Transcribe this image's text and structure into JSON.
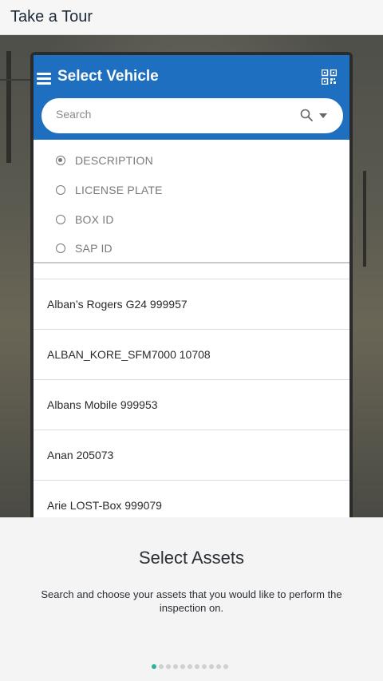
{
  "header": {
    "title": "Take a Tour"
  },
  "app": {
    "title": "Select Vehicle",
    "search_placeholder": "Search",
    "search_options": [
      {
        "label": "DESCRIPTION",
        "selected": true
      },
      {
        "label": "LICENSE PLATE",
        "selected": false
      },
      {
        "label": "BOX ID",
        "selected": false
      },
      {
        "label": "SAP ID",
        "selected": false
      }
    ],
    "vehicles": [
      "Alban’s Rogers G24 999957",
      "ALBAN_KORE_SFM7000 10708",
      "Albans Mobile 999953",
      "Anan 205073",
      "Arie LOST-Box 999079"
    ],
    "icons": {
      "menu": "hamburger-menu-icon",
      "qr": "qr-code-icon",
      "search": "search-icon",
      "dropdown": "caret-down-icon"
    },
    "colors": {
      "appbar": "#1f6fc1"
    }
  },
  "tour": {
    "title": "Select Assets",
    "description": "Search and choose your assets that you would like to perform the inspection on.",
    "page_indicator": {
      "total": 11,
      "current": 1
    },
    "colors": {
      "active_dot": "#2bb49a"
    }
  }
}
